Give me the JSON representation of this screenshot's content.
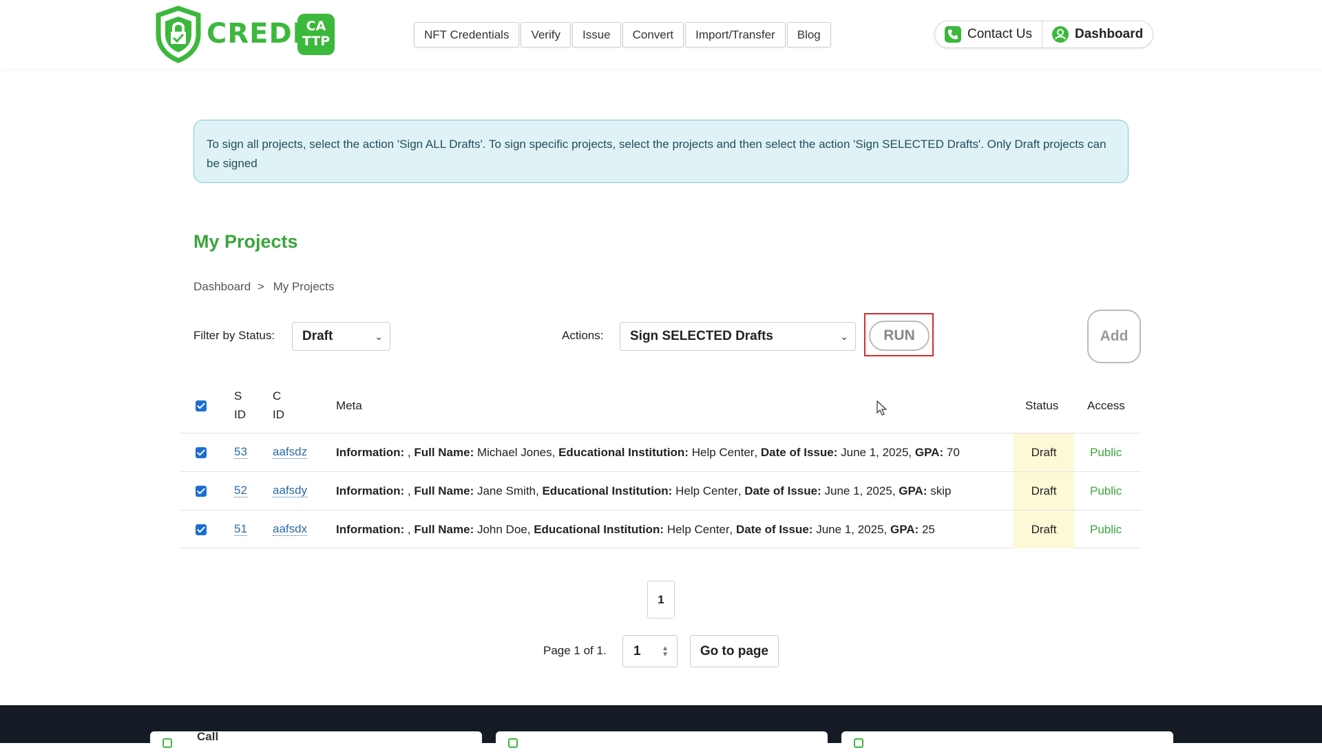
{
  "brand": {
    "logo_word": "CREDLY",
    "logo_badge_line1": "CA",
    "logo_badge_line2": "TTP",
    "accent_color": "#3cb83c"
  },
  "nav": {
    "items": [
      "NFT Credentials",
      "Verify",
      "Issue",
      "Convert",
      "Import/Transfer",
      "Blog"
    ]
  },
  "header_right": {
    "contact": "Contact Us",
    "dashboard": "Dashboard"
  },
  "alert": {
    "text": "To sign all projects, select the action 'Sign ALL Drafts'. To sign specific projects, select the projects and then select the action 'Sign SELECTED Drafts'. Only Draft projects can be signed"
  },
  "page": {
    "title": "My Projects"
  },
  "breadcrumb": {
    "root": "Dashboard",
    "separator": ">",
    "current": "My Projects"
  },
  "filter": {
    "label": "Filter by Status:",
    "value": "Draft"
  },
  "actions": {
    "label": "Actions:",
    "value": "Sign SELECTED Drafts",
    "run": "RUN",
    "add": "Add"
  },
  "table": {
    "headers": {
      "s_id_1": "S",
      "s_id_2": "ID",
      "c_id_1": "C",
      "c_id_2": "ID",
      "meta": "Meta",
      "status": "Status",
      "access": "Access"
    },
    "meta_labels": {
      "information": "Information:",
      "full_name": "Full Name:",
      "institution": "Educational Institution:",
      "date": "Date of Issue:",
      "gpa": "GPA:"
    },
    "rows": [
      {
        "s_id": "53",
        "c_id": "aafsdz",
        "full_name": "Michael Jones",
        "institution": "Help Center",
        "date": "June 1, 2025",
        "gpa": "70",
        "status": "Draft",
        "access": "Public"
      },
      {
        "s_id": "52",
        "c_id": "aafsdy",
        "full_name": "Jane Smith",
        "institution": "Help Center",
        "date": "June 1, 2025",
        "gpa": "skip",
        "status": "Draft",
        "access": "Public"
      },
      {
        "s_id": "51",
        "c_id": "aafsdx",
        "full_name": "John Doe",
        "institution": "Help Center",
        "date": "June 1, 2025",
        "gpa": "25",
        "status": "Draft",
        "access": "Public"
      }
    ]
  },
  "pagination": {
    "current": "1",
    "info": "Page 1 of 1.",
    "input_value": "1",
    "go_label": "Go to page"
  },
  "footer": {
    "card1_label": "Call"
  }
}
